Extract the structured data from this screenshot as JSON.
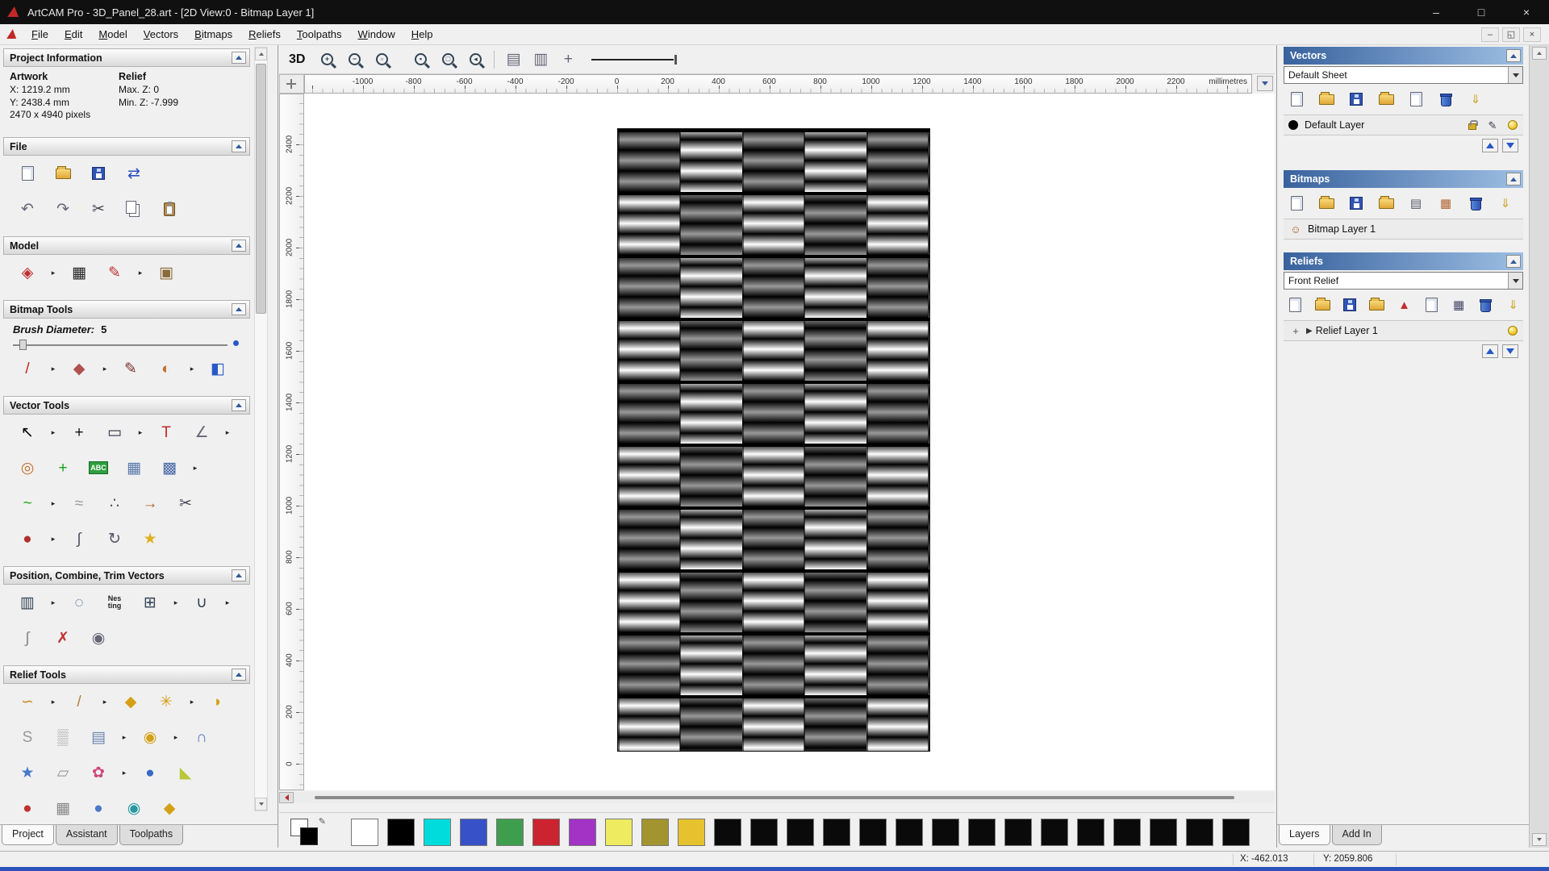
{
  "window": {
    "title": "ArtCAM Pro - 3D_Panel_28.art - [2D View:0 - Bitmap Layer 1]",
    "controls": {
      "minimize": "–",
      "maximize": "□",
      "close": "×"
    },
    "mdi_controls": {
      "minimize": "–",
      "restore": "◱",
      "close": "×"
    }
  },
  "menu": {
    "items": [
      {
        "label": "File"
      },
      {
        "label": "Edit"
      },
      {
        "label": "Model"
      },
      {
        "label": "Vectors"
      },
      {
        "label": "Bitmaps"
      },
      {
        "label": "Reliefs"
      },
      {
        "label": "Toolpaths"
      },
      {
        "label": "Window"
      },
      {
        "label": "Help"
      }
    ]
  },
  "left": {
    "project_info": {
      "title": "Project Information",
      "artwork_heading": "Artwork",
      "relief_heading": "Relief",
      "artwork_x": "X: 1219.2 mm",
      "artwork_y": "Y: 2438.4 mm",
      "artwork_pixels": "2470 x 4940 pixels",
      "relief_max": "Max. Z: 0",
      "relief_min": "Min. Z: -7.999"
    },
    "file": {
      "title": "File",
      "row1": [
        {
          "n": "new-model-icon",
          "s": "page"
        },
        {
          "n": "open-model-icon",
          "s": "folder"
        },
        {
          "n": "save-model-icon",
          "s": "floppy"
        },
        {
          "n": "model-transfer-icon",
          "g": "⇄",
          "c": "#2a4fc0"
        }
      ],
      "row2": [
        {
          "n": "undo-icon",
          "g": "↶",
          "c": "#667"
        },
        {
          "n": "redo-icon",
          "g": "↷",
          "c": "#667"
        },
        {
          "n": "cut-icon",
          "g": "✂",
          "c": "#445"
        },
        {
          "n": "copy-icon",
          "s": "copy"
        },
        {
          "n": "paste-icon",
          "s": "paste"
        }
      ]
    },
    "model": {
      "title": "Model",
      "row": [
        {
          "n": "set-model-size-icon",
          "g": "◈",
          "c": "#c03030"
        },
        {
          "n": "flyout-arrow-icon",
          "g": "▸",
          "c": "#222",
          "k": "fly"
        },
        {
          "n": "greyscale-model-icon",
          "g": "▦",
          "c": "#222"
        },
        {
          "n": "adjust-model-icon",
          "g": "✎",
          "c": "#c03030"
        },
        {
          "n": "flyout-arrow-icon",
          "g": "▸",
          "c": "#222",
          "k": "fly"
        },
        {
          "n": "model-preview-icon",
          "g": "▣",
          "c": "#8a6a3a"
        }
      ]
    },
    "bitmap_tools": {
      "title": "Bitmap Tools",
      "brush_label": "Brush Diameter:",
      "brush_value": "5",
      "row": [
        {
          "n": "paint-brush-icon",
          "g": "/",
          "c": "#c22020"
        },
        {
          "n": "flyout-arrow-icon",
          "g": "▸",
          "c": "#222",
          "k": "fly"
        },
        {
          "n": "paint-selective-icon",
          "g": "◆",
          "c": "#b05050"
        },
        {
          "n": "flyout-arrow-icon",
          "g": "▸",
          "c": "#222",
          "k": "fly"
        },
        {
          "n": "colour-dropper-icon",
          "g": "✎",
          "c": "#7a3030"
        },
        {
          "n": "palette-icon",
          "g": "◐",
          "c": "#c07030"
        },
        {
          "n": "flyout-arrow-icon",
          "g": "▸",
          "c": "#222",
          "k": "fly"
        },
        {
          "n": "flood-fill-icon",
          "g": "◧",
          "c": "#2858c8"
        }
      ]
    },
    "vector_tools": {
      "title": "Vector Tools",
      "rows": [
        [
          {
            "n": "select-vectors-icon",
            "g": "↖",
            "c": "#000"
          },
          {
            "n": "flyout-arrow-icon",
            "g": "▸",
            "c": "#222",
            "k": "fly"
          },
          {
            "n": "transform-vectors-icon",
            "g": "+",
            "c": "#111"
          },
          {
            "n": "create-rectangle-icon",
            "g": "▭",
            "c": "#334"
          },
          {
            "n": "flyout-arrow-icon",
            "g": "▸",
            "c": "#222",
            "k": "fly"
          },
          {
            "n": "create-text-icon",
            "g": "T",
            "c": "#c22828"
          },
          {
            "n": "measure-tool-icon",
            "g": "∠",
            "c": "#667"
          },
          {
            "n": "flyout-arrow-icon",
            "g": "▸",
            "c": "#222",
            "k": "fly"
          }
        ],
        [
          {
            "n": "offset-vectors-icon",
            "g": "◎",
            "c": "#c07030"
          },
          {
            "n": "create-polyline-icon",
            "g": "+",
            "c": "#18a018"
          },
          {
            "n": "text-abc-icon",
            "g": "ABC",
            "s": "abc"
          },
          {
            "n": "vector-grid-icon",
            "g": "▦",
            "c": "#5878a8"
          },
          {
            "n": "array-copy-icon",
            "g": "▩",
            "c": "#4868a8"
          },
          {
            "n": "flyout-arrow-icon",
            "g": "▸",
            "c": "#222",
            "k": "fly"
          }
        ],
        [
          {
            "n": "create-curve-icon",
            "g": "~",
            "c": "#18a018"
          },
          {
            "n": "flyout-arrow-icon",
            "g": "▸",
            "c": "#222",
            "k": "fly"
          },
          {
            "n": "freehand-curve-icon",
            "g": "≈",
            "c": "#999"
          },
          {
            "n": "node-editing-icon",
            "g": "∴",
            "c": "#556"
          },
          {
            "n": "create-arc-icon",
            "g": "→",
            "c": "#b06020"
          },
          {
            "n": "trim-vectors-icon",
            "g": "✂",
            "c": "#445"
          }
        ],
        [
          {
            "n": "extrude-vector-icon",
            "g": "●",
            "c": "#b03030"
          },
          {
            "n": "flyout-arrow-icon",
            "g": "▸",
            "c": "#222",
            "k": "fly"
          },
          {
            "n": "snap-nodes-icon",
            "g": "∫",
            "c": "#556"
          },
          {
            "n": "rotate-vectors-icon",
            "g": "↻",
            "c": "#556"
          },
          {
            "n": "create-star-icon",
            "g": "★",
            "c": "#e0b020"
          }
        ]
      ]
    },
    "position_tools": {
      "title": "Position, Combine, Trim Vectors",
      "rows": [
        [
          {
            "n": "align-vectors-icon",
            "g": "▥",
            "c": "#345"
          },
          {
            "n": "flyout-arrow-icon",
            "g": "▸",
            "c": "#222",
            "k": "fly"
          },
          {
            "n": "circular-array-icon",
            "g": "◌",
            "c": "#357"
          },
          {
            "n": "nesting-icon",
            "g": "Nes\nting",
            "s": "txt"
          },
          {
            "n": "block-array-icon",
            "g": "⊞",
            "c": "#345"
          },
          {
            "n": "flyout-arrow-icon",
            "g": "▸",
            "c": "#222",
            "k": "fly"
          },
          {
            "n": "weld-vectors-icon",
            "g": "∪",
            "c": "#345"
          },
          {
            "n": "flyout-arrow-icon",
            "g": "▸",
            "c": "#222",
            "k": "fly"
          }
        ],
        [
          {
            "n": "join-vectors-icon",
            "g": "∫",
            "c": "#888"
          },
          {
            "n": "vector-doctor-icon",
            "g": "✗",
            "c": "#c03030"
          },
          {
            "n": "create-spiral-icon",
            "g": "◉",
            "c": "#667"
          }
        ]
      ]
    },
    "relief_tools": {
      "title": "Relief Tools",
      "rows": [
        [
          {
            "n": "smooth-relief-icon",
            "g": "∽",
            "c": "#c89020"
          },
          {
            "n": "flyout-arrow-icon",
            "g": "▸",
            "c": "#222",
            "k": "fly"
          },
          {
            "n": "sculpt-relief-icon",
            "g": "/",
            "c": "#b08040"
          },
          {
            "n": "flyout-arrow-icon",
            "g": "▸",
            "c": "#222",
            "k": "fly"
          },
          {
            "n": "add-clay-icon",
            "g": "◆",
            "c": "#d4a017"
          },
          {
            "n": "texture-relief-icon",
            "g": "✳",
            "c": "#d4a017"
          },
          {
            "n": "flyout-arrow-icon",
            "g": "▸",
            "c": "#222",
            "k": "fly"
          },
          {
            "n": "spin-relief-icon",
            "g": "◗",
            "c": "#d4a017"
          }
        ],
        [
          {
            "n": "smooth-tool-icon",
            "g": "S",
            "c": "#999"
          },
          {
            "n": "wireframe-relief-icon",
            "g": "▒",
            "c": "#999"
          },
          {
            "n": "offset-relief-icon",
            "g": "▤",
            "c": "#6a85b0"
          },
          {
            "n": "flyout-arrow-icon",
            "g": "▸",
            "c": "#222",
            "k": "fly"
          },
          {
            "n": "two-rail-sweep-icon",
            "g": "◉",
            "c": "#d4a017"
          },
          {
            "n": "flyout-arrow-icon",
            "g": "▸",
            "c": "#222",
            "k": "fly"
          },
          {
            "n": "dome-relief-icon",
            "g": "∩",
            "c": "#5878c0"
          }
        ],
        [
          {
            "n": "star-relief-icon",
            "g": "★",
            "c": "#4878c8"
          },
          {
            "n": "envelope-relief-icon",
            "g": "▱",
            "c": "#999"
          },
          {
            "n": "turn-relief-icon",
            "g": "✿",
            "c": "#d04878"
          },
          {
            "n": "flyout-arrow-icon",
            "g": "▸",
            "c": "#222",
            "k": "fly"
          },
          {
            "n": "sphere-relief-icon",
            "g": "●",
            "c": "#3868c8"
          },
          {
            "n": "wedge-relief-icon",
            "g": "◣",
            "c": "#b8c838"
          }
        ],
        [
          {
            "n": "paint-relief-icon",
            "g": "●",
            "c": "#c03030"
          },
          {
            "n": "mesh-relief-icon",
            "g": "▦",
            "c": "#888"
          },
          {
            "n": "bulge-relief-icon",
            "g": "●",
            "c": "#4878c8"
          },
          {
            "n": "swirl-relief-icon",
            "g": "◉",
            "c": "#2898a0"
          },
          {
            "n": "crown-relief-icon",
            "g": "◆",
            "c": "#d4a017"
          }
        ]
      ]
    },
    "tabs": [
      {
        "label": "Project",
        "active": true
      },
      {
        "label": "Assistant"
      },
      {
        "label": "Toolpaths"
      }
    ]
  },
  "canvas": {
    "view3d_label": "3D",
    "zoom_icons": [
      {
        "n": "zoom-in-icon",
        "s": "mag",
        "g": "+"
      },
      {
        "n": "zoom-out-icon",
        "s": "mag",
        "g": "−"
      },
      {
        "n": "zoom-box-icon",
        "s": "mag",
        "g": "▫"
      },
      {
        "n": "zoom-objects-icon",
        "s": "mag",
        "g": "▪",
        "k": "gap"
      },
      {
        "n": "zoom-page-icon",
        "s": "mag",
        "g": "□"
      },
      {
        "n": "zoom-previous-icon",
        "s": "mag",
        "g": "◂"
      }
    ],
    "view_toggle_icons": [
      {
        "n": "toggle-bitmap-view-icon",
        "g": "▤",
        "c": "#667"
      },
      {
        "n": "toggle-vector-view-icon",
        "g": "▥",
        "c": "#667"
      },
      {
        "n": "pan-view-icon",
        "g": "+",
        "c": "#667"
      }
    ],
    "ruler": {
      "unit": "millimetres",
      "h_ticks": [
        "-1000",
        "-800",
        "-600",
        "-400",
        "-200",
        "0",
        "200",
        "400",
        "600",
        "800",
        "1000",
        "1200",
        "1400",
        "1600",
        "1800",
        "2000",
        "2200"
      ],
      "v_ticks": [
        "2400",
        "2200",
        "2000",
        "1800",
        "1600",
        "1400",
        "1200",
        "1000",
        "800",
        "600",
        "400",
        "200",
        "0"
      ]
    },
    "artwork": {
      "pattern": "woven-slats",
      "colors": [
        "#000000",
        "#ffffff"
      ]
    }
  },
  "right": {
    "vectors": {
      "title": "Vectors",
      "sheet_value": "Default Sheet",
      "toolbar": [
        {
          "n": "new-vector-layer-icon",
          "s": "page"
        },
        {
          "n": "open-vector-layer-icon",
          "s": "folder"
        },
        {
          "n": "save-vector-layer-icon",
          "s": "floppy"
        },
        {
          "n": "import-vectors-icon",
          "s": "folder"
        },
        {
          "n": "export-vectors-icon",
          "s": "page"
        },
        {
          "n": "delete-vector-layer-icon",
          "s": "trash"
        },
        {
          "n": "merge-vector-layers-icon",
          "g": "⇓",
          "c": "#c8a020"
        }
      ],
      "layer": {
        "label": "Default Layer"
      },
      "layer_icons": [
        {
          "n": "lock-layer-icon",
          "s": "lock"
        },
        {
          "n": "edit-layer-icon",
          "g": "✎",
          "c": "#334"
        },
        {
          "n": "layer-visibility-icon",
          "s": "bulb"
        }
      ]
    },
    "bitmaps": {
      "title": "Bitmaps",
      "toolbar": [
        {
          "n": "new-bitmap-layer-icon",
          "s": "page"
        },
        {
          "n": "open-bitmap-layer-icon",
          "s": "folder"
        },
        {
          "n": "save-bitmap-layer-icon",
          "s": "floppy"
        },
        {
          "n": "import-bitmap-icon",
          "s": "folder"
        },
        {
          "n": "bitmap-attributes-icon",
          "g": "▤",
          "c": "#556"
        },
        {
          "n": "colour-reduction-icon",
          "g": "▦",
          "c": "#b06030"
        },
        {
          "n": "delete-bitmap-layer-icon",
          "s": "trash"
        },
        {
          "n": "merge-bitmap-layers-icon",
          "g": "⇓",
          "c": "#c8a020"
        }
      ],
      "layer": {
        "label": "Bitmap Layer 1"
      },
      "layer_prefix_icons": [
        {
          "n": "bitmap-layer-thumb-icon",
          "g": "☺",
          "c": "#a06028"
        }
      ]
    },
    "reliefs": {
      "title": "Reliefs",
      "relief_value": "Front Relief",
      "toolbar": [
        {
          "n": "new-relief-layer-icon",
          "s": "page"
        },
        {
          "n": "open-relief-layer-icon",
          "s": "folder"
        },
        {
          "n": "save-relief-layer-icon",
          "s": "floppy"
        },
        {
          "n": "import-relief-icon",
          "s": "folder"
        },
        {
          "n": "calculate-relief-icon",
          "g": "▲",
          "c": "#c03030"
        },
        {
          "n": "export-relief-icon",
          "s": "page"
        },
        {
          "n": "relief-info-icon",
          "g": "▦",
          "c": "#446"
        },
        {
          "n": "delete-relief-layer-icon",
          "s": "trash"
        },
        {
          "n": "merge-relief-layers-icon",
          "g": "⇓",
          "c": "#c8a020"
        }
      ],
      "layer": {
        "label": "Relief Layer 1"
      },
      "layer_prefix_icons": [
        {
          "n": "new-relief-sublayer-icon",
          "g": "+",
          "c": "#555"
        }
      ],
      "layer_suffix_icons": [
        {
          "n": "relief-visibility-icon",
          "s": "bulb"
        }
      ]
    },
    "tabs": [
      {
        "label": "Layers",
        "active": true
      },
      {
        "label": "Add In"
      }
    ]
  },
  "palette": {
    "colors": [
      "#ffffff",
      "#000000",
      "#00dcdc",
      "#3752c8",
      "#3f9e4e",
      "#cc2330",
      "#a233c4",
      "#eeeb60",
      "#a2952f",
      "#e7c22f",
      "#0a0a0a",
      "#0a0a0a",
      "#0a0a0a",
      "#0a0a0a",
      "#0a0a0a",
      "#0a0a0a",
      "#0a0a0a",
      "#0a0a0a",
      "#0a0a0a",
      "#0a0a0a",
      "#0a0a0a",
      "#0a0a0a",
      "#0a0a0a",
      "#0a0a0a",
      "#0a0a0a"
    ]
  },
  "status": {
    "x": "X: -462.013",
    "y": "Y: 2059.806"
  }
}
